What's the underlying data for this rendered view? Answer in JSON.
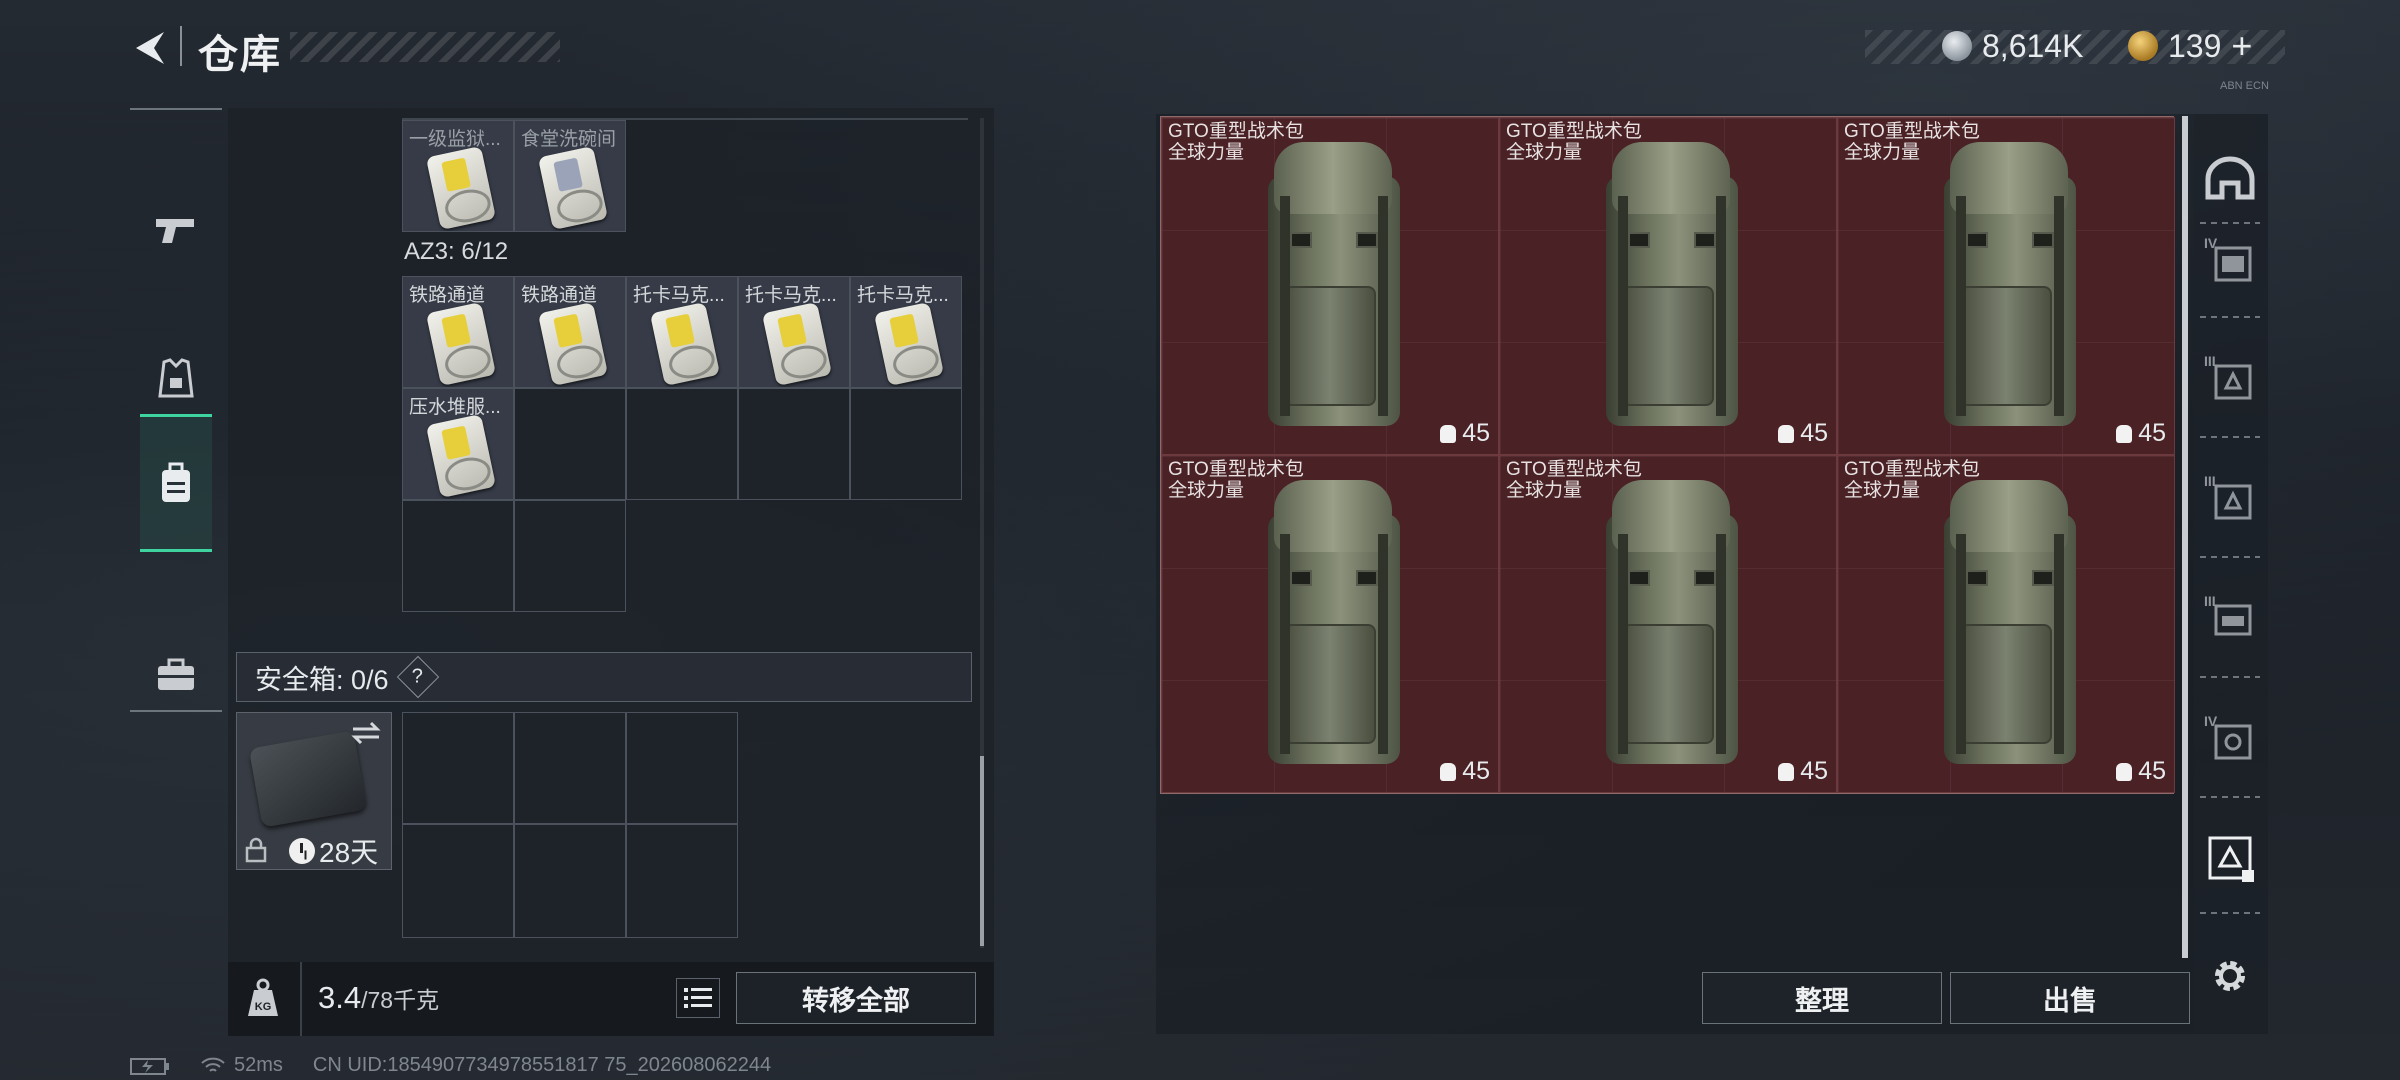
{
  "header": {
    "title": "仓库"
  },
  "currency": {
    "silver": "8,614K",
    "gold": "139",
    "gold_plus": "+",
    "small_code": "ABN ECN"
  },
  "left_tabs": [
    {
      "icon": "gun-icon"
    },
    {
      "icon": "armor-icon"
    },
    {
      "icon": "backpack-icon",
      "active": true
    },
    {
      "icon": "toolbox-icon"
    }
  ],
  "container": {
    "top_items": [
      "一级监狱...",
      "食堂洗碗间"
    ],
    "label": "AZ3: 6/12",
    "items_row1": [
      "铁路通道",
      "铁路通道",
      "托卡马克...",
      "托卡马克...",
      "托卡马克..."
    ],
    "items_row2": [
      "压水堆服..."
    ]
  },
  "safe_box": {
    "label": "安全箱: 0/6",
    "help": "?",
    "days": "28天"
  },
  "bottom": {
    "weight": "3.4",
    "capacity": "/78千克",
    "kg_icon": "KG",
    "transfer_all": "转移全部"
  },
  "backpacks": [
    {
      "name": "GTO重型战术包",
      "sub": "全球力量",
      "weight": "45"
    },
    {
      "name": "GTO重型战术包",
      "sub": "全球力量",
      "weight": "45"
    },
    {
      "name": "GTO重型战术包",
      "sub": "全球力量",
      "weight": "45"
    },
    {
      "name": "GTO重型战术包",
      "sub": "全球力量",
      "weight": "45"
    },
    {
      "name": "GTO重型战术包",
      "sub": "全球力量",
      "weight": "45"
    },
    {
      "name": "GTO重型战术包",
      "sub": "全球力量",
      "weight": "45"
    }
  ],
  "actions": {
    "sort": "整理",
    "sell": "出售"
  },
  "filters": [
    "IV",
    "III",
    "III",
    "III",
    "IV"
  ],
  "status": {
    "ping": "52ms",
    "uid": "CN UID:1854907734978551817 75_202608062244"
  }
}
